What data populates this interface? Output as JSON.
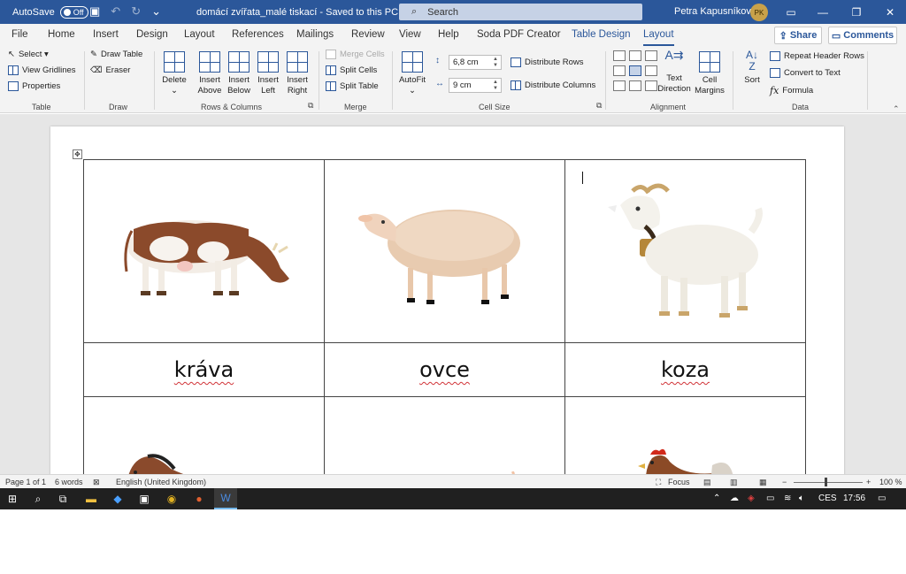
{
  "titlebar": {
    "autosave_label": "AutoSave",
    "autosave_state": "Off",
    "doc_title": "domácí zvířata_malé tiskací  -  Saved to this PC ▾",
    "search_placeholder": "Search",
    "user_name": "Petra Kapusníková",
    "user_initials": "PK"
  },
  "tabs": [
    {
      "label": "File"
    },
    {
      "label": "Home"
    },
    {
      "label": "Insert"
    },
    {
      "label": "Design"
    },
    {
      "label": "Layout"
    },
    {
      "label": "References"
    },
    {
      "label": "Mailings"
    },
    {
      "label": "Review"
    },
    {
      "label": "View"
    },
    {
      "label": "Help"
    },
    {
      "label": "Soda PDF Creator"
    },
    {
      "label": "Table Design"
    },
    {
      "label": "Layout"
    }
  ],
  "share_label": "Share",
  "comments_label": "Comments",
  "ribbon": {
    "table": {
      "select": "Select ▾",
      "view_gridlines": "View Gridlines",
      "properties": "Properties",
      "label": "Table"
    },
    "draw": {
      "draw_table": "Draw Table",
      "eraser": "Eraser",
      "label": "Draw"
    },
    "rows_cols": {
      "delete": "Delete",
      "insert_above": "Insert Above",
      "insert_below": "Insert Below",
      "insert_left": "Insert Left",
      "insert_right": "Insert Right",
      "label": "Rows & Columns"
    },
    "merge": {
      "merge_cells": "Merge Cells",
      "split_cells": "Split Cells",
      "split_table": "Split Table",
      "label": "Merge"
    },
    "cell_size": {
      "autofit": "AutoFit",
      "height": "6,8 cm",
      "width": "9 cm",
      "distribute_rows": "Distribute Rows",
      "distribute_columns": "Distribute Columns",
      "label": "Cell Size"
    },
    "alignment": {
      "text_direction": "Text Direction",
      "cell_margins": "Cell Margins",
      "label": "Alignment"
    },
    "data": {
      "sort": "Sort",
      "repeat_header_rows": "Repeat Header Rows",
      "convert_to_text": "Convert to Text",
      "formula": "Formula",
      "label": "Data"
    }
  },
  "document": {
    "animals_row1": [
      {
        "word": "kráva",
        "icon": "cow-image"
      },
      {
        "word": "ovce",
        "icon": "sheep-image"
      },
      {
        "word": "koza",
        "icon": "goat-image"
      }
    ],
    "animals_row2": [
      {
        "icon": "horse-image"
      },
      {
        "icon": "pig-image"
      },
      {
        "icon": "hen-image"
      }
    ]
  },
  "statusbar": {
    "page": "Page 1 of 1",
    "words": "6 words",
    "language": "English (United Kingdom)",
    "focus": "Focus",
    "zoom": "100 %"
  },
  "taskbar": {
    "language": "CES",
    "time": "17:56"
  }
}
